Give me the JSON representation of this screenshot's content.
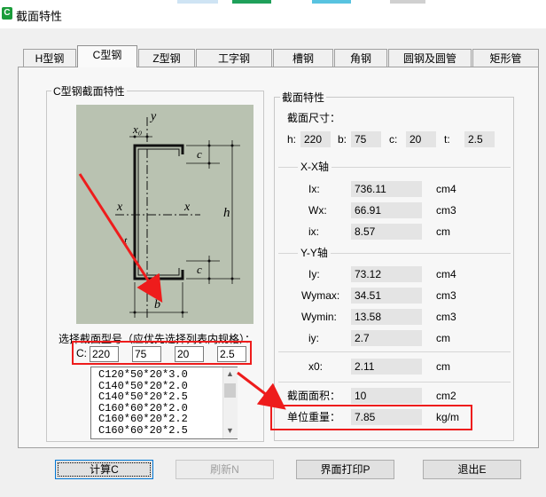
{
  "window": {
    "title": "截面特性",
    "app_icon": "C"
  },
  "tabs": [
    {
      "label": "H型钢",
      "active": false
    },
    {
      "label": "C型钢",
      "active": true
    },
    {
      "label": "Z型钢",
      "active": false
    },
    {
      "label": "工字钢",
      "active": false
    },
    {
      "label": "槽钢",
      "active": false
    },
    {
      "label": "角钢",
      "active": false
    },
    {
      "label": "圆钢及圆管",
      "active": false
    },
    {
      "label": "矩形管",
      "active": false
    }
  ],
  "left_group": {
    "title": "C型钢截面特性",
    "diagram_labels": {
      "y": "y",
      "x0": "x₀",
      "c_top": "c",
      "c_bottom": "c",
      "x_left": "x",
      "x_right": "x",
      "h": "h",
      "b": "b",
      "t": "t"
    },
    "select_hint": "选择截面型号（应优先选择列表内规格）：",
    "c_label": "C:",
    "inputs": [
      "220",
      "75",
      "20",
      "2.5"
    ],
    "list_items": [
      "C120*50*20*3.0",
      "C140*50*20*2.0",
      "C140*50*20*2.5",
      "C160*60*20*2.0",
      "C160*60*20*2.2",
      "C160*60*20*2.5"
    ]
  },
  "right_group": {
    "title": "截面特性",
    "dims_title": "截面尺寸：",
    "dims": [
      {
        "label": "h:",
        "value": "220"
      },
      {
        "label": "b:",
        "value": "75"
      },
      {
        "label": "c:",
        "value": "20"
      },
      {
        "label": "t:",
        "value": "2.5"
      }
    ],
    "xx_title": "X-X轴",
    "xx_rows": [
      {
        "label": "Ix:",
        "value": "736.11",
        "unit": "cm4"
      },
      {
        "label": "Wx:",
        "value": "66.91",
        "unit": "cm3"
      },
      {
        "label": "ix:",
        "value": "8.57",
        "unit": "cm"
      }
    ],
    "yy_title": "Y-Y轴",
    "yy_rows": [
      {
        "label": "Iy:",
        "value": "73.12",
        "unit": "cm4"
      },
      {
        "label": "Wymax:",
        "value": "34.51",
        "unit": "cm3"
      },
      {
        "label": "Wymin:",
        "value": "13.58",
        "unit": "cm3"
      },
      {
        "label": "iy:",
        "value": "2.7",
        "unit": "cm"
      }
    ],
    "x0": {
      "label": "x0:",
      "value": "2.11",
      "unit": "cm"
    },
    "area": {
      "label": "截面面积：",
      "value": "10",
      "unit": "cm2"
    },
    "weight": {
      "label": "单位重量：",
      "value": "7.85",
      "unit": "kg/m"
    }
  },
  "buttons": {
    "calc": "计算C",
    "refresh": "刷新N",
    "print": "界面打印P",
    "exit": "退出E"
  },
  "highlight_color": "#ee1c1c"
}
